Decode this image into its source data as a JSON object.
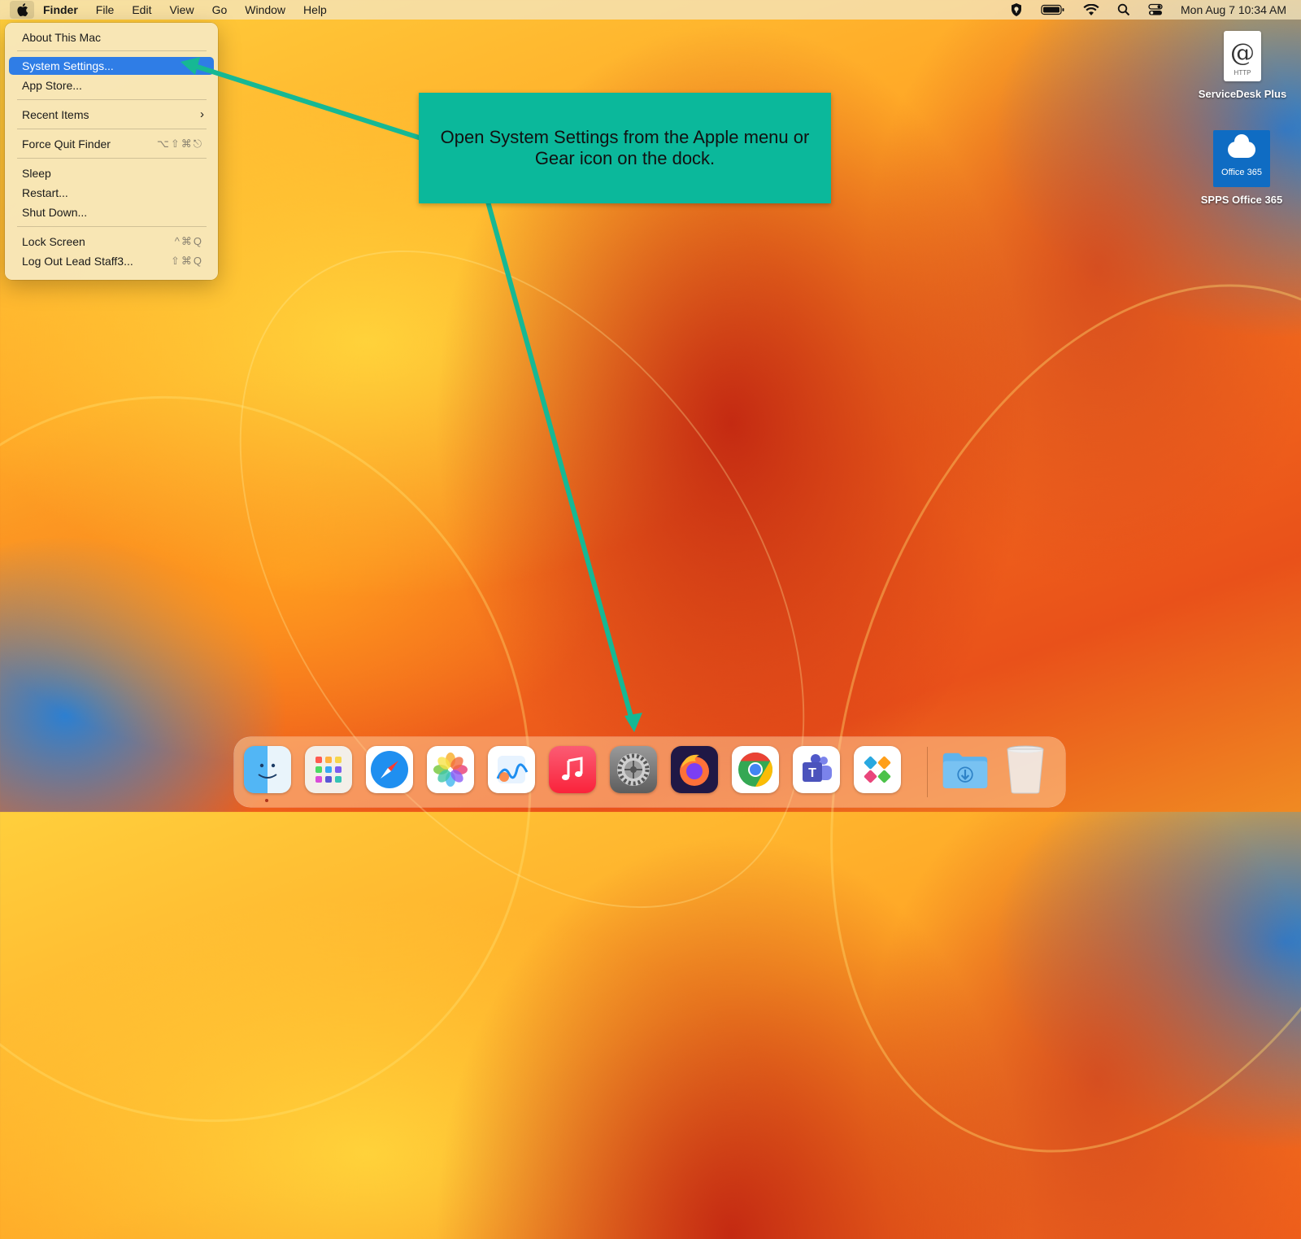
{
  "menubar": {
    "app_name": "Finder",
    "menus": [
      "File",
      "Edit",
      "View",
      "Go",
      "Window",
      "Help"
    ],
    "clock": "Mon Aug 7  10:34 AM",
    "status_icons": [
      "shield-icon",
      "battery-icon",
      "wifi-icon",
      "spotlight-icon",
      "control-center-icon"
    ]
  },
  "apple_menu": {
    "items": [
      {
        "label": "About This Mac",
        "shortcut": ""
      },
      {
        "label": "System Settings...",
        "shortcut": "",
        "highlighted": true
      },
      {
        "label": "App Store...",
        "shortcut": ""
      },
      {
        "label": "Recent Items",
        "shortcut": "",
        "submenu": true
      },
      {
        "label": "Force Quit Finder",
        "shortcut": "⌥⇧⌘⎋"
      },
      {
        "label": "Sleep",
        "shortcut": ""
      },
      {
        "label": "Restart...",
        "shortcut": ""
      },
      {
        "label": "Shut Down...",
        "shortcut": ""
      },
      {
        "label": "Lock Screen",
        "shortcut": "^⌘Q"
      },
      {
        "label": "Log Out Lead Staff3...",
        "shortcut": "⇧⌘Q"
      }
    ],
    "submenu_glyph": "›"
  },
  "desktop": {
    "icons": [
      {
        "label": "ServiceDesk Plus",
        "glyph": "@",
        "subtext": "HTTP"
      },
      {
        "label": "SPPS Office 365",
        "subtext": "Office 365"
      }
    ]
  },
  "callout": {
    "text": "Open System Settings from the Apple menu or Gear icon on the dock."
  },
  "dock": {
    "apps": [
      "finder-icon",
      "launchpad-icon",
      "safari-icon",
      "photos-icon",
      "freeform-icon",
      "music-icon",
      "system-settings-icon",
      "firefox-icon",
      "chrome-icon",
      "teams-icon",
      "self-service-icon",
      "downloads-folder-icon",
      "trash-icon"
    ]
  },
  "colors": {
    "callout_bg": "#0bb89b",
    "menu_highlight": "#2f7de6",
    "arrow": "#16b894"
  }
}
